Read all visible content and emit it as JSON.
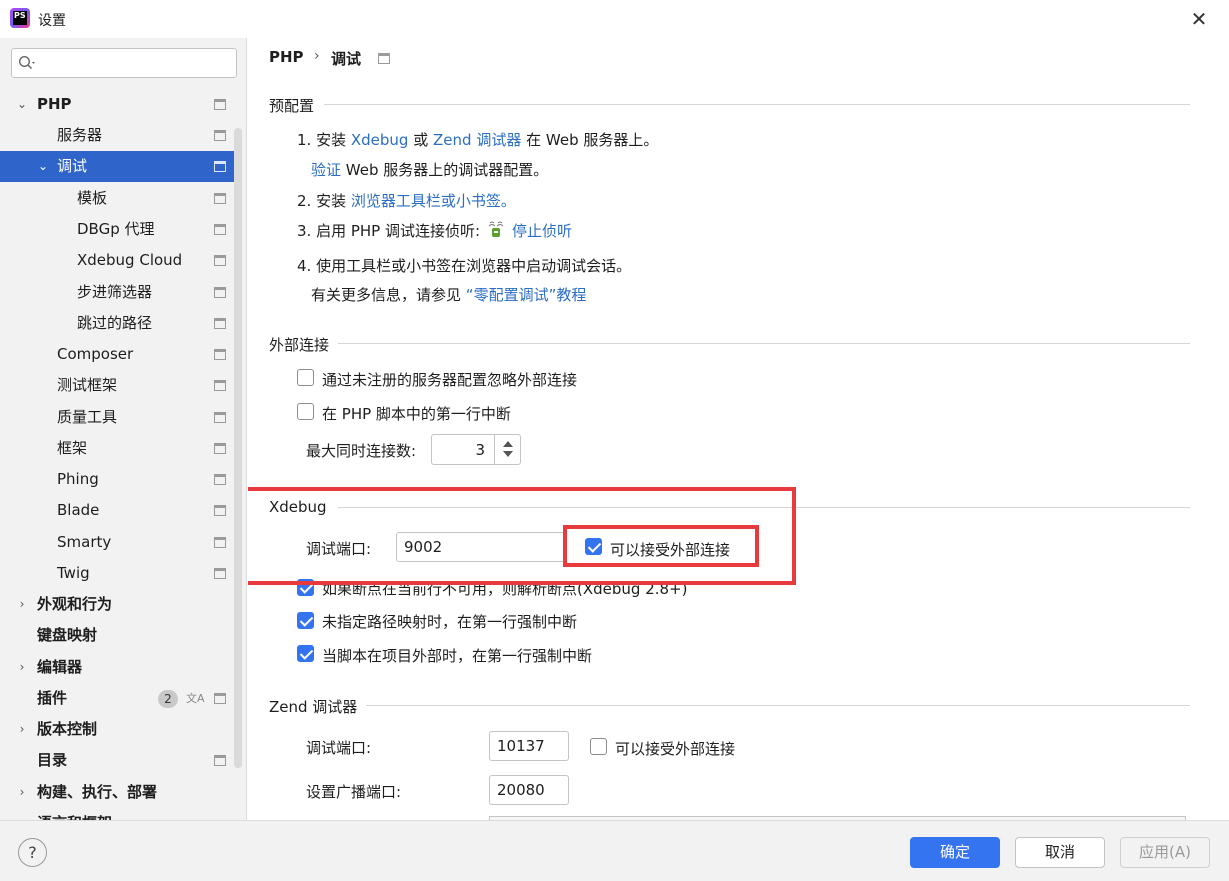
{
  "window": {
    "title": "设置",
    "app_icon_text": "PS",
    "close_glyph": "✕"
  },
  "search": {
    "placeholder": "",
    "icon": "search-icon"
  },
  "sidebar": {
    "items": [
      {
        "label": "PHP",
        "expand": "⌄",
        "bold": true
      },
      {
        "label": "服务器"
      },
      {
        "label": "调试",
        "expand": "⌄",
        "selected": true
      },
      {
        "label": "模板"
      },
      {
        "label": "DBGp 代理"
      },
      {
        "label": "Xdebug Cloud"
      },
      {
        "label": "步进筛选器"
      },
      {
        "label": "跳过的路径"
      },
      {
        "label": "Composer"
      },
      {
        "label": "测试框架"
      },
      {
        "label": "质量工具"
      },
      {
        "label": "框架"
      },
      {
        "label": "Phing"
      },
      {
        "label": "Blade"
      },
      {
        "label": "Smarty"
      },
      {
        "label": "Twig"
      },
      {
        "label": "外观和行为",
        "expand": "›",
        "bold": true
      },
      {
        "label": "键盘映射",
        "bold": true
      },
      {
        "label": "编辑器",
        "expand": "›",
        "bold": true
      },
      {
        "label": "插件",
        "bold": true,
        "badge": "2"
      },
      {
        "label": "版本控制",
        "expand": "›",
        "bold": true
      },
      {
        "label": "目录",
        "bold": true
      },
      {
        "label": "构建、执行、部署",
        "expand": "›",
        "bold": true
      },
      {
        "label": "语言和框架",
        "expand": "›",
        "bold": true
      }
    ]
  },
  "breadcrumb": {
    "root": "PHP",
    "sep": "›",
    "current": "调试"
  },
  "preconfig": {
    "title": "预配置",
    "step1_prefix": "1. 安装",
    "step1_link1": "Xdebug",
    "step1_or": "或",
    "step1_link2": "Zend 调试器",
    "step1_suffix": "在 Web 服务器上。",
    "verify_link": "验证",
    "verify_suffix": "Web 服务器上的调试器配置。",
    "step2_prefix": "2. 安装",
    "step2_link": "浏览器工具栏或小书签。",
    "step3_prefix": "3. 启用 PHP 调试连接侦听:",
    "step3_link": "停止侦听",
    "step4": "4. 使用工具栏或小书签在浏览器中启动调试会话。",
    "more_prefix": "有关更多信息，请参见",
    "more_link": "“零配置调试”教程"
  },
  "external": {
    "title": "外部连接",
    "ignore_label": "通过未注册的服务器配置忽略外部连接",
    "ignore_checked": false,
    "break_first_label": "在 PHP 脚本中的第一行中断",
    "break_first_checked": false,
    "max_conn_label": "最大同时连接数:",
    "max_conn_value": "3"
  },
  "xdebug": {
    "title": "Xdebug",
    "port_label": "调试端口:",
    "port_value": "9002",
    "accept_label": "可以接受外部连接",
    "accept_checked": true,
    "resolve_label": "如果断点在当前行不可用，则解析断点(Xdebug 2.8+)",
    "resolve_checked": true,
    "no_mapping_label": "未指定路径映射时，在第一行强制中断",
    "no_mapping_checked": true,
    "outside_label": "当脚本在项目外部时，在第一行强制中断",
    "outside_checked": true
  },
  "zend": {
    "title": "Zend 调试器",
    "port_label": "调试端口:",
    "port_value": "10137",
    "accept_label": "可以接受外部连接",
    "accept_checked": false,
    "broadcast_label": "设置广播端口:",
    "broadcast_value": "20080"
  },
  "footer": {
    "help": "?",
    "ok": "确定",
    "cancel": "取消",
    "apply": "应用(A)"
  },
  "colors": {
    "accent": "#3574f0",
    "link": "#2b6ec5",
    "highlight_box": "#e8393d",
    "selection": "#2f65ca"
  }
}
